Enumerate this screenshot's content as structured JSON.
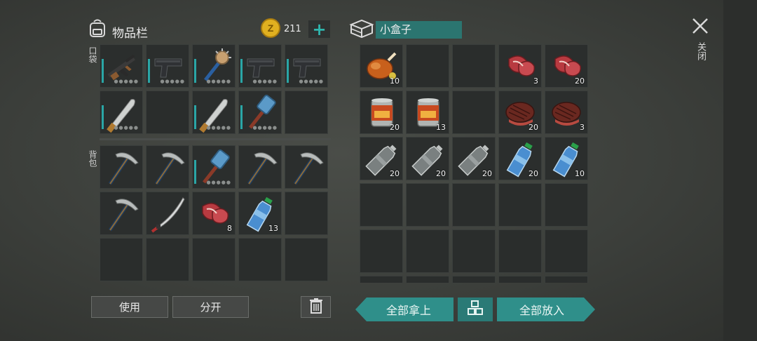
{
  "inventory": {
    "title": "物品栏",
    "coins": "211",
    "plus_icon": "plus-icon",
    "pocket_label": "口袋",
    "backpack_label": "背包",
    "pocket_slots": [
      {
        "item": "assault-rifle",
        "count": "",
        "stars": true
      },
      {
        "item": "pistol",
        "count": "",
        "stars": true
      },
      {
        "item": "spiked-mace",
        "count": "",
        "stars": true
      },
      {
        "item": "pistol",
        "count": "",
        "stars": true
      },
      {
        "item": "pistol",
        "count": "",
        "stars": true
      },
      {
        "item": "machete",
        "count": "",
        "stars": true
      },
      {
        "item": "",
        "count": ""
      },
      {
        "item": "machete",
        "count": "",
        "stars": true
      },
      {
        "item": "hammer",
        "count": "",
        "stars": true
      },
      {
        "item": "",
        "count": ""
      }
    ],
    "backpack_slots": [
      {
        "item": "pickaxe",
        "count": ""
      },
      {
        "item": "pickaxe",
        "count": ""
      },
      {
        "item": "hammer",
        "count": "",
        "stars": true
      },
      {
        "item": "pickaxe",
        "count": ""
      },
      {
        "item": "pickaxe",
        "count": ""
      },
      {
        "item": "pickaxe",
        "count": ""
      },
      {
        "item": "katana",
        "count": ""
      },
      {
        "item": "raw-meat",
        "count": "8"
      },
      {
        "item": "water-bottle",
        "count": "13"
      },
      {
        "item": "",
        "count": ""
      },
      {
        "item": "",
        "count": ""
      },
      {
        "item": "",
        "count": ""
      },
      {
        "item": "",
        "count": ""
      },
      {
        "item": "",
        "count": ""
      },
      {
        "item": "",
        "count": ""
      }
    ],
    "use_button": "使用",
    "split_button": "分开",
    "trash_icon": "trash-icon"
  },
  "container": {
    "name": "小盒子",
    "box_icon": "box-icon",
    "slots": [
      {
        "item": "roast-chicken",
        "count": "10"
      },
      {
        "item": "",
        "count": ""
      },
      {
        "item": "",
        "count": ""
      },
      {
        "item": "raw-meat",
        "count": "3"
      },
      {
        "item": "raw-meat",
        "count": "20"
      },
      {
        "item": "canned-food",
        "count": "20"
      },
      {
        "item": "canned-food",
        "count": "13"
      },
      {
        "item": "",
        "count": ""
      },
      {
        "item": "steak",
        "count": "20"
      },
      {
        "item": "steak",
        "count": "3"
      },
      {
        "item": "empty-bottle",
        "count": "20"
      },
      {
        "item": "empty-bottle",
        "count": "20"
      },
      {
        "item": "empty-bottle",
        "count": "20"
      },
      {
        "item": "water-bottle",
        "count": "20"
      },
      {
        "item": "water-bottle",
        "count": "10"
      },
      {
        "item": "",
        "count": ""
      },
      {
        "item": "",
        "count": ""
      },
      {
        "item": "",
        "count": ""
      },
      {
        "item": "",
        "count": ""
      },
      {
        "item": "",
        "count": ""
      },
      {
        "item": "",
        "count": ""
      },
      {
        "item": "",
        "count": ""
      },
      {
        "item": "",
        "count": ""
      },
      {
        "item": "",
        "count": ""
      },
      {
        "item": "",
        "count": ""
      },
      {
        "item": "",
        "count": ""
      },
      {
        "item": "",
        "count": ""
      },
      {
        "item": "",
        "count": ""
      },
      {
        "item": "",
        "count": ""
      },
      {
        "item": "",
        "count": ""
      }
    ],
    "take_all_button": "全部拿上",
    "sort_icon": "grid-sort-icon",
    "put_all_button": "全部放入"
  },
  "close": {
    "label": "关闭",
    "icon": "close-icon"
  },
  "colors": {
    "accent": "#2f8f8a",
    "coin": "#e0b020"
  }
}
